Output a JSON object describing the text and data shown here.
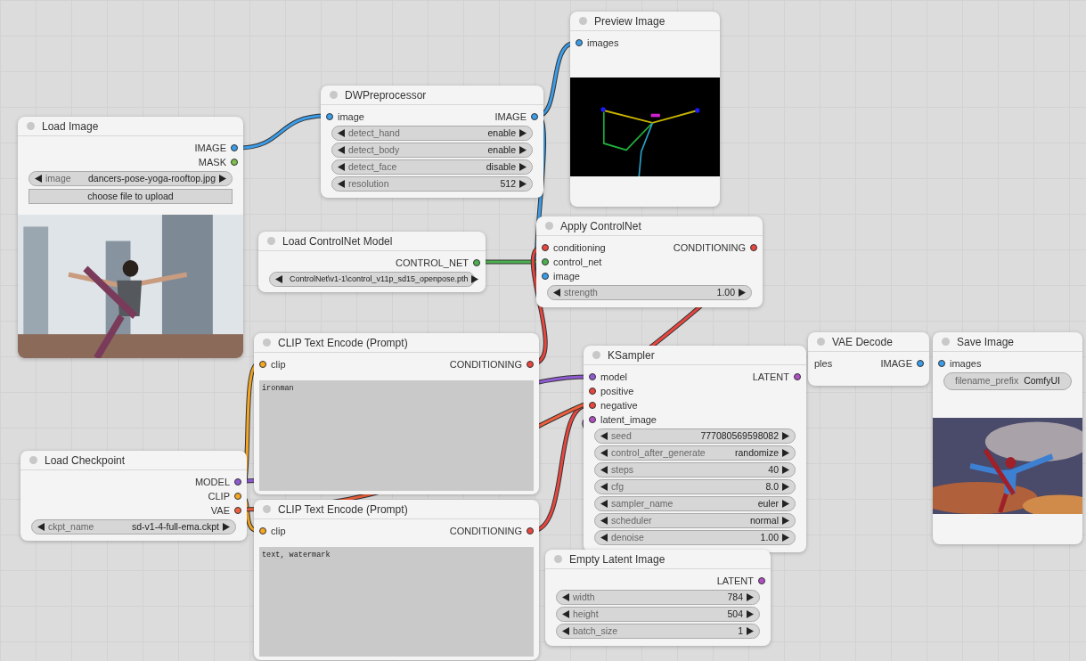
{
  "nodes": [
    {
      "title": "Load Image",
      "outputs": [
        {
          "label": "IMAGE",
          "color": "#3b9ce8"
        },
        {
          "label": "MASK",
          "color": "#7cbf4a"
        }
      ],
      "widgets": [
        {
          "kind": "combo",
          "label": "image",
          "value": "dancers-pose-yoga-rooftop.jpg"
        }
      ],
      "button": "choose file to upload",
      "preview": {
        "kind": "picture"
      }
    },
    {
      "title": "DWPreprocessor",
      "inputs": [
        {
          "label": "image",
          "color": "#3b9ce8"
        }
      ],
      "outputs": [
        {
          "label": "IMAGE",
          "color": "#3b9ce8"
        }
      ],
      "widgets": [
        {
          "kind": "combo",
          "label": "detect_hand",
          "value": "enable"
        },
        {
          "kind": "combo",
          "label": "detect_body",
          "value": "enable"
        },
        {
          "kind": "combo",
          "label": "detect_face",
          "value": "disable"
        },
        {
          "kind": "combo",
          "label": "resolution",
          "value": "512"
        }
      ]
    },
    {
      "title": "Preview Image",
      "inputs": [
        {
          "label": "images",
          "color": "#3b9ce8"
        }
      ],
      "preview": {
        "kind": "picture"
      }
    },
    {
      "title": "Load ControlNet Model",
      "outputs": [
        {
          "label": "CONTROL_NET",
          "color": "#4caf50"
        }
      ],
      "widgets": [
        {
          "kind": "combo",
          "value": "ControlNet\\v1-1\\control_v11p_sd15_openpose.pth"
        }
      ]
    },
    {
      "title": "Apply ControlNet",
      "inputs": [
        {
          "label": "conditioning",
          "color": "#e8463f"
        },
        {
          "label": "control_net",
          "color": "#4caf50"
        },
        {
          "label": "image",
          "color": "#3b9ce8"
        }
      ],
      "outputs": [
        {
          "label": "CONDITIONING",
          "color": "#e8463f"
        }
      ],
      "widgets": [
        {
          "kind": "combo",
          "label": "strength",
          "value": "1.00"
        }
      ]
    },
    {
      "title": "CLIP Text Encode (Prompt)",
      "inputs": [
        {
          "label": "clip",
          "color": "#f5a623"
        }
      ],
      "outputs": [
        {
          "label": "CONDITIONING",
          "color": "#e8463f"
        }
      ],
      "textarea": "ironman"
    },
    {
      "title": "VAE Decode",
      "inputs": [
        {
          "label": "ples"
        }
      ],
      "outputs": [
        {
          "label": "IMAGE",
          "color": "#3b9ce8"
        }
      ]
    },
    {
      "title": "KSampler",
      "inputs": [
        {
          "label": "model",
          "color": "#8e5bd0"
        },
        {
          "label": "positive",
          "color": "#e8463f"
        },
        {
          "label": "negative",
          "color": "#e8463f"
        },
        {
          "label": "latent_image",
          "color": "#b04fc4"
        }
      ],
      "outputs": [
        {
          "label": "LATENT",
          "color": "#b04fc4"
        }
      ],
      "widgets": [
        {
          "kind": "combo",
          "label": "seed",
          "value": "777080569598082"
        },
        {
          "kind": "combo",
          "label": "control_after_generate",
          "value": "randomize"
        },
        {
          "kind": "combo",
          "label": "steps",
          "value": "40"
        },
        {
          "kind": "combo",
          "label": "cfg",
          "value": "8.0"
        },
        {
          "kind": "combo",
          "label": "sampler_name",
          "value": "euler"
        },
        {
          "kind": "combo",
          "label": "scheduler",
          "value": "normal"
        },
        {
          "kind": "combo",
          "label": "denoise",
          "value": "1.00"
        }
      ]
    },
    {
      "title": "Save Image",
      "inputs": [
        {
          "label": "images",
          "color": "#3b9ce8"
        }
      ],
      "widgets": [
        {
          "kind": "text",
          "label": "filename_prefix",
          "value": "ComfyUI"
        }
      ],
      "preview": {
        "kind": "picture"
      }
    },
    {
      "title": "Load Checkpoint",
      "outputs": [
        {
          "label": "MODEL",
          "color": "#8e5bd0"
        },
        {
          "label": "CLIP",
          "color": "#f5a623"
        },
        {
          "label": "VAE",
          "color": "#f0603c"
        }
      ],
      "widgets": [
        {
          "kind": "combo",
          "label": "ckpt_name",
          "value": "sd-v1-4-full-ema.ckpt"
        }
      ]
    },
    {
      "title": "CLIP Text Encode (Prompt)",
      "inputs": [
        {
          "label": "clip",
          "color": "#f5a623"
        }
      ],
      "outputs": [
        {
          "label": "CONDITIONING",
          "color": "#e8463f"
        }
      ],
      "textarea": "text, watermark"
    },
    {
      "title": "Empty Latent Image",
      "outputs": [
        {
          "label": "LATENT",
          "color": "#b04fc4"
        }
      ],
      "widgets": [
        {
          "kind": "combo",
          "label": "width",
          "value": "784"
        },
        {
          "kind": "combo",
          "label": "height",
          "value": "504"
        },
        {
          "kind": "combo",
          "label": "batch_size",
          "value": "1"
        }
      ]
    }
  ]
}
